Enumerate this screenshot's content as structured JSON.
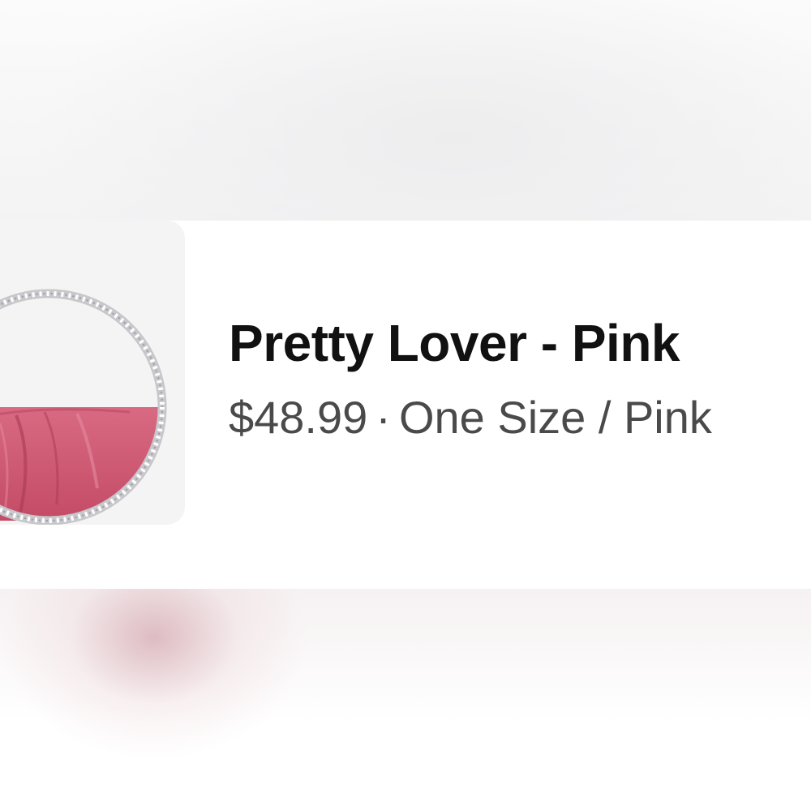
{
  "product": {
    "title": "Pretty Lover - Pink",
    "price": "$48.99",
    "separator": "·",
    "variant": "One Size / Pink",
    "image_alt_icon": "handbag-icon"
  },
  "colors": {
    "bag_pink": "#cf5670",
    "title_text": "#111111",
    "meta_text": "#4a4a4a"
  }
}
